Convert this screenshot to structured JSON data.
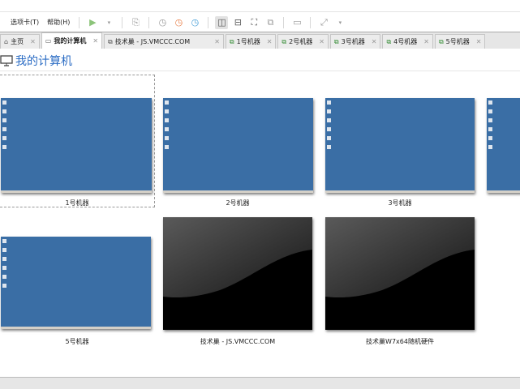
{
  "menu": {
    "tabs_label": "选项卡(T)",
    "help_label": "帮助(H)"
  },
  "tabs": [
    {
      "label": "主页",
      "icon": "home-icon"
    },
    {
      "label": "我的计算机",
      "icon": "computer-icon"
    },
    {
      "label": "技术巢 - JS.VMCCC.COM",
      "icon": "vm-icon"
    },
    {
      "label": "1号机器",
      "icon": "vm-running-icon"
    },
    {
      "label": "2号机器",
      "icon": "vm-running-icon"
    },
    {
      "label": "3号机器",
      "icon": "vm-running-icon"
    },
    {
      "label": "4号机器",
      "icon": "vm-running-icon"
    },
    {
      "label": "5号机器",
      "icon": "vm-running-icon"
    }
  ],
  "page_title": "我的计算机",
  "machines": [
    {
      "label": "1号机器"
    },
    {
      "label": "2号机器"
    },
    {
      "label": "3号机器"
    },
    {
      "label": "5号机器"
    },
    {
      "label": "技术巢 - JS.VMCCC.COM"
    },
    {
      "label": "技术巢W7x64随机硬件"
    }
  ]
}
